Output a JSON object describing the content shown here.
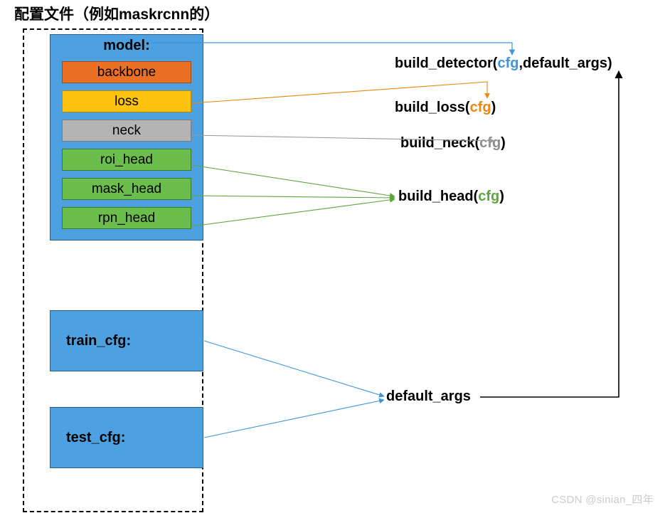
{
  "title": "配置文件（例如maskrcnn的）",
  "config": {
    "model_label": "model:",
    "components": {
      "backbone": "backbone",
      "loss": "loss",
      "neck": "neck",
      "roi_head": "roi_head",
      "mask_head": "mask_head",
      "rpn_head": "rpn_head"
    },
    "train_cfg_label": "train_cfg:",
    "test_cfg_label": "test_cfg:"
  },
  "builders": {
    "build_detector": {
      "name": "build_detector",
      "arg1": "cfg",
      "arg2": "default_args"
    },
    "build_loss": {
      "name": "build_loss",
      "arg1": "cfg"
    },
    "build_neck": {
      "name": "build_neck",
      "arg1": "cfg"
    },
    "build_head": {
      "name": "build_head",
      "arg1": "cfg"
    }
  },
  "default_args_label": "default_args",
  "watermark": "CSDN @sinian_四年",
  "colors": {
    "blue": "#4EA1E0",
    "orange": "#EA7024",
    "yellow": "#FDC30E",
    "gray": "#B4B4B4",
    "green": "#6BBE4B",
    "cfg_blue": "#3e95da",
    "cfg_orange": "#e98712",
    "cfg_gray": "#8d8d8d",
    "cfg_green": "#5aa73d"
  }
}
